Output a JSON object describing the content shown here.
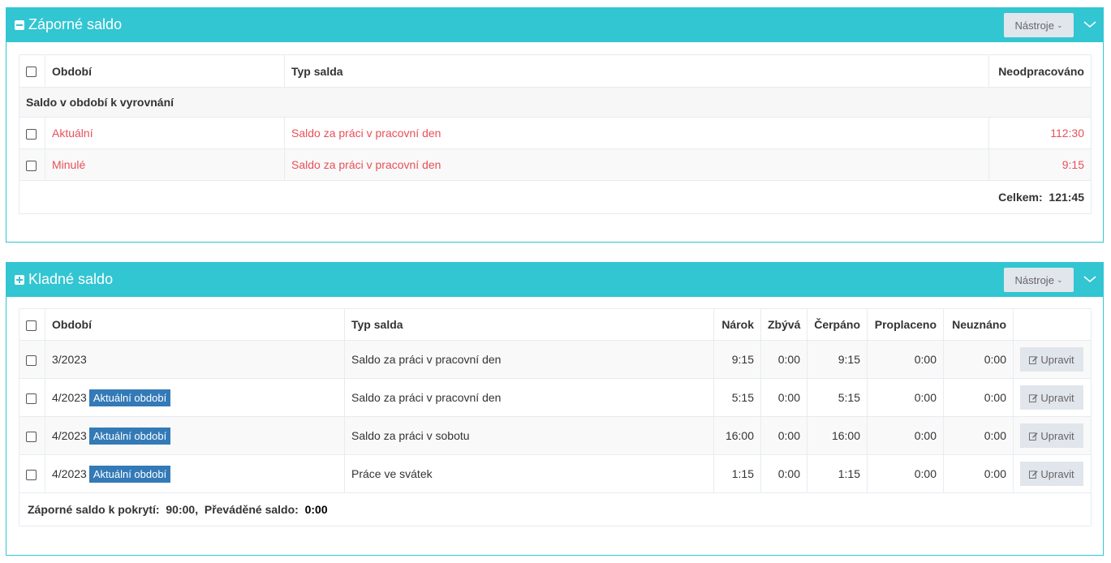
{
  "negative": {
    "title": "Záporné saldo",
    "tools_label": "Nástroje",
    "columns": {
      "period": "Období",
      "type": "Typ salda",
      "unworked": "Neodpracováno"
    },
    "group_label": "Saldo v období k vyrovnání",
    "rows": [
      {
        "period": "Aktuální",
        "type": "Saldo za práci v pracovní den",
        "unworked": "112:30"
      },
      {
        "period": "Minulé",
        "type": "Saldo za práci v pracovní den",
        "unworked": "9:15"
      }
    ],
    "total_label": "Celkem:",
    "total_value": "121:45"
  },
  "positive": {
    "title": "Kladné saldo",
    "tools_label": "Nástroje",
    "columns": {
      "period": "Období",
      "type": "Typ salda",
      "claim": "Nárok",
      "remaining": "Zbývá",
      "used": "Čerpáno",
      "paid": "Proplaceno",
      "unrecognized": "Neuznáno"
    },
    "badge_label": "Aktuální období",
    "edit_label": "Upravit",
    "rows": [
      {
        "period": "3/2023",
        "current": false,
        "type": "Saldo za práci v pracovní den",
        "claim": "9:15",
        "remaining": "0:00",
        "used": "9:15",
        "paid": "0:00",
        "unrecognized": "0:00"
      },
      {
        "period": "4/2023",
        "current": true,
        "type": "Saldo za práci v pracovní den",
        "claim": "5:15",
        "remaining": "0:00",
        "used": "5:15",
        "paid": "0:00",
        "unrecognized": "0:00"
      },
      {
        "period": "4/2023",
        "current": true,
        "type": "Saldo za práci v sobotu",
        "claim": "16:00",
        "remaining": "0:00",
        "used": "16:00",
        "paid": "0:00",
        "unrecognized": "0:00"
      },
      {
        "period": "4/2023",
        "current": true,
        "type": "Práce ve svátek",
        "claim": "1:15",
        "remaining": "0:00",
        "used": "1:15",
        "paid": "0:00",
        "unrecognized": "0:00"
      }
    ],
    "footer_cover_label": "Záporné saldo k pokrytí:",
    "footer_cover_value": "90:00",
    "footer_transfer_label": "Převáděné saldo:",
    "footer_transfer_value": "0:00"
  },
  "colors": {
    "header": "#32c5d2",
    "negative_text": "#e7505a",
    "badge": "#337ab7"
  }
}
